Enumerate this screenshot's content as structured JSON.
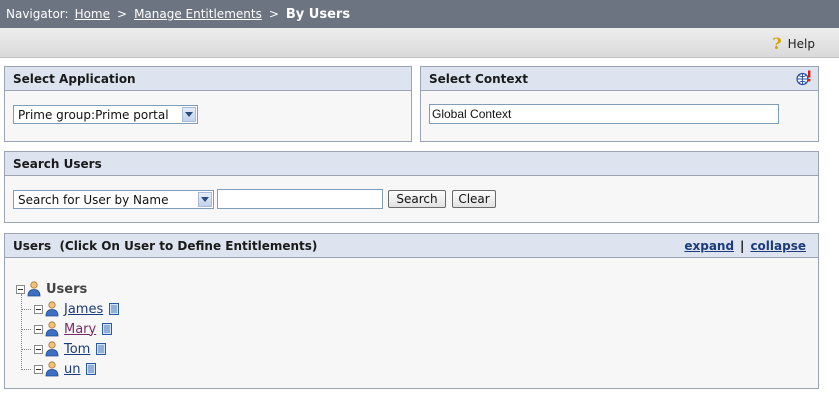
{
  "navigator": {
    "prefix": "Navigator:",
    "home": "Home",
    "sep1": ">",
    "manage": "Manage Entitlements",
    "sep2": ">",
    "current": "By Users"
  },
  "toolbar": {
    "help_label": "Help",
    "help_icon": "question-mark-icon"
  },
  "select_application": {
    "title": "Select Application",
    "selected": "Prime group:Prime portal"
  },
  "select_context": {
    "title": "Select Context",
    "value": "Global Context",
    "icon": "context-globe-icon"
  },
  "search_users": {
    "title": "Search Users",
    "mode_selected": "Search for User by Name",
    "query_value": "",
    "search_label": "Search",
    "clear_label": "Clear"
  },
  "users_panel": {
    "title": "Users  (Click On User to Define Entitlements)",
    "expand_label": "expand",
    "divider": "|",
    "collapse_label": "collapse",
    "root_label": "Users",
    "users": [
      {
        "name": "James",
        "visited": false
      },
      {
        "name": "Mary",
        "visited": true
      },
      {
        "name": "Tom",
        "visited": false
      },
      {
        "name": "un",
        "visited": false
      }
    ]
  },
  "figure_number": "275115",
  "colors": {
    "navbar_bg": "#6c7482",
    "panel_header_bg": "#dde4ef",
    "link": "#1b3b7a",
    "visited_link": "#7a2b66"
  }
}
